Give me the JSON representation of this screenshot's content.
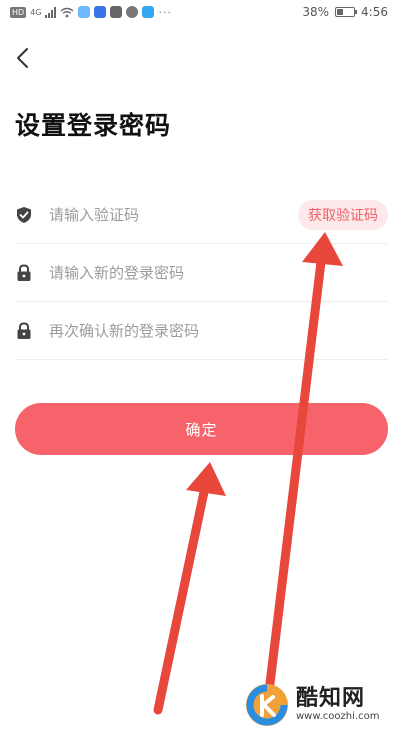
{
  "status_bar": {
    "chip": "HD",
    "network_label": "4G",
    "overflow": "···",
    "battery_text": "38%",
    "battery_level": 0.38,
    "time": "4:56"
  },
  "header": {
    "back_icon": "chevron-left-icon",
    "title": "设置登录密码"
  },
  "form": {
    "code_field": {
      "icon": "shield-check-icon",
      "placeholder": "请输入验证码",
      "value": ""
    },
    "get_code_label": "获取验证码",
    "new_password_field": {
      "icon": "lock-icon",
      "placeholder": "请输入新的登录密码",
      "value": ""
    },
    "confirm_password_field": {
      "icon": "lock-icon",
      "placeholder": "再次确认新的登录密码",
      "value": ""
    }
  },
  "confirm_label": "确定",
  "watermark": {
    "brand": "酷知网",
    "url": "www.coozhi.com"
  },
  "colors": {
    "accent": "#f7636b",
    "accent_light": "#fde8ea",
    "annotation_arrow": "#e8473b"
  }
}
